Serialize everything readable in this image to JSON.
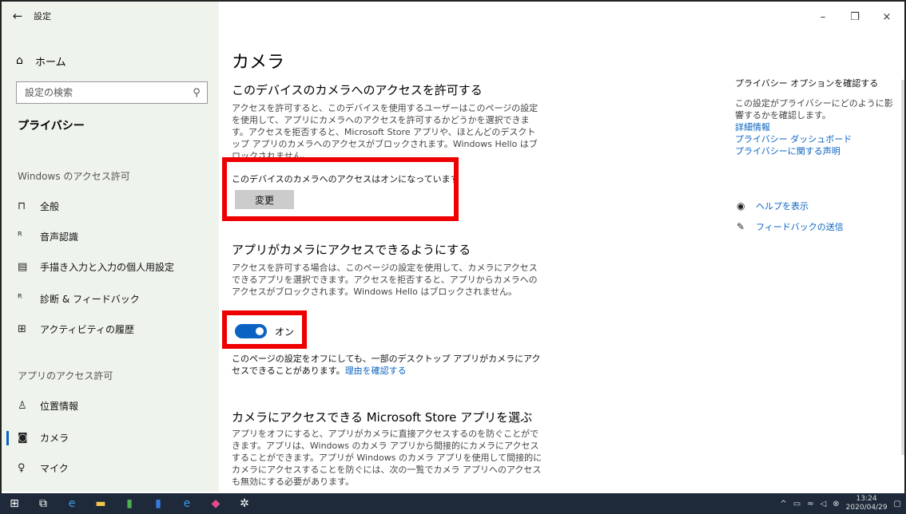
{
  "window": {
    "app_title": "設定",
    "back_icon": "back-arrow-icon",
    "minimize": "–",
    "maximize": "❐",
    "close": "×"
  },
  "sidebar": {
    "home_label": "ホーム",
    "search_placeholder": "設定の検索",
    "category": "プライバシー",
    "windows_section": "Windows のアクセス許可",
    "windows_items": [
      {
        "label": "全般",
        "icon": "lock-icon"
      },
      {
        "label": "音声認識",
        "icon": "speech-icon"
      },
      {
        "label": "手描き入力と入力の個人用設定",
        "icon": "pen-icon"
      },
      {
        "label": "診断 & フィードバック",
        "icon": "diagnostics-icon"
      },
      {
        "label": "アクティビティの履歴",
        "icon": "timeline-icon"
      }
    ],
    "app_section": "アプリのアクセス許可",
    "app_items": [
      {
        "label": "位置情報",
        "icon": "location-icon"
      },
      {
        "label": "カメラ",
        "icon": "camera-icon",
        "active": true
      },
      {
        "label": "マイク",
        "icon": "microphone-icon"
      }
    ]
  },
  "main": {
    "title": "カメラ",
    "device_heading": "このデバイスのカメラへのアクセスを許可する",
    "device_para": "アクセスを許可すると、このデバイスを使用するユーザーはこのページの設定を使用して、アプリにカメラへのアクセスを許可するかどうかを選択できます。アクセスを拒否すると、Microsoft Store アプリや、ほとんどのデスクトップ アプリのカメラへのアクセスがブロックされます。Windows Hello はブロックされません。",
    "device_status": "このデバイスのカメラへのアクセスはオンになっています",
    "change_button": "変更",
    "apps_heading": "アプリがカメラにアクセスできるようにする",
    "apps_para": "アクセスを許可する場合は、このページの設定を使用して、カメラにアクセスできるアプリを選択できます。アクセスを拒否すると、アプリからカメラへのアクセスがブロックされます。Windows Hello はブロックされません。",
    "toggle_label": "オン",
    "note_text": "このページの設定をオフにしても、一部のデスクトップ アプリがカメラにアクセスできることがあります。",
    "note_link": "理由を確認する",
    "store_heading": "カメラにアクセスできる Microsoft Store アプリを選ぶ",
    "store_para": "アプリをオフにすると、アプリがカメラに直接アクセスするのを防ぐことができます。アプリは、Windows のカメラ アプリから間接的にカメラにアクセスすることができます。アプリが Windows のカメラ アプリを使用して間接的にカメラにアクセスすることを防ぐには、次の一覧でカメラ アプリへのアクセスも無効にする必要があります。"
  },
  "right": {
    "heading": "プライバシー オプションを確認する",
    "desc": "この設定がプライバシーにどのように影響するかを確認します。",
    "links": [
      "詳細情報",
      "プライバシー ダッシュボード",
      "プライバシーに関する声明"
    ],
    "help": "ヘルプを表示",
    "feedback": "フィードバックの送信"
  },
  "taskbar": {
    "time": "13:24",
    "date": "2020/04/29",
    "highlight_color": "#e00000",
    "accent": "#0a63c2"
  }
}
